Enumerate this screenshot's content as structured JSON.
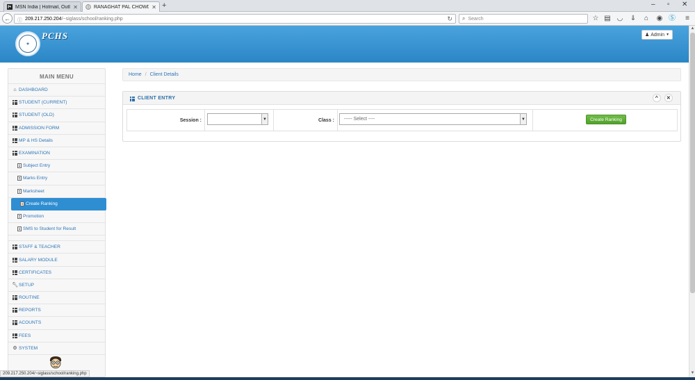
{
  "browser": {
    "tabs": [
      {
        "title": "MSN India | Hotmail, Outlo...",
        "active": false
      },
      {
        "title": "RANAGHAT PAL CHOWD...",
        "active": true
      }
    ],
    "url_host": "209.217.250.204",
    "url_path": "/~siglass/school/ranking.php",
    "search_placeholder": "Search",
    "status_url": "209.217.250.204/~siglass/school/ranking.php"
  },
  "header": {
    "brand": "PCHS",
    "admin_label": "Admin",
    "accent_color": "#2f8ed2"
  },
  "sidebar": {
    "title": "MAIN MENU",
    "items": [
      {
        "label": "DASHBOARD",
        "icon": "home-icon"
      },
      {
        "label": "STUDENT (CURRENT)",
        "icon": "grid-icon"
      },
      {
        "label": "STUDENT (OLD)",
        "icon": "grid-icon"
      },
      {
        "label": "ADMISSION FORM",
        "icon": "grid-icon"
      },
      {
        "label": "MP & HS Details",
        "icon": "grid-icon"
      },
      {
        "label": "EXAMINATION",
        "icon": "grid-icon"
      }
    ],
    "subitems": [
      {
        "label": "Subject Entry",
        "icon": "list-icon"
      },
      {
        "label": "Marks Entry",
        "icon": "list-icon"
      },
      {
        "label": "Marksheet",
        "icon": "list-icon"
      },
      {
        "label": "Create Ranking",
        "icon": "list-icon",
        "active": true
      },
      {
        "label": "Promotion",
        "icon": "list-icon"
      },
      {
        "label": "SMS to Student for Result",
        "icon": "list-icon"
      }
    ],
    "items2": [
      {
        "label": "STAFF & TEACHER",
        "icon": "grid-icon"
      },
      {
        "label": "SALARY MODULE",
        "icon": "grid-icon"
      },
      {
        "label": "CERTIFICATES",
        "icon": "grid-icon"
      },
      {
        "label": "SETUP",
        "icon": "wrench-icon"
      },
      {
        "label": "ROUTINE",
        "icon": "grid-icon"
      },
      {
        "label": "REPORTS",
        "icon": "grid-icon"
      },
      {
        "label": "ACOUNTS",
        "icon": "grid-icon"
      },
      {
        "label": "FEES",
        "icon": "grid-icon"
      },
      {
        "label": "SYSTEM",
        "icon": "cogs-icon"
      }
    ]
  },
  "breadcrumb": {
    "home": "Home",
    "current": "Client Details"
  },
  "panel": {
    "title": "CLIENT ENTRY",
    "session_label": "Session :",
    "session_value": "",
    "class_label": "Class :",
    "class_value": "----- Select ----",
    "create_button": "Create Ranking"
  }
}
